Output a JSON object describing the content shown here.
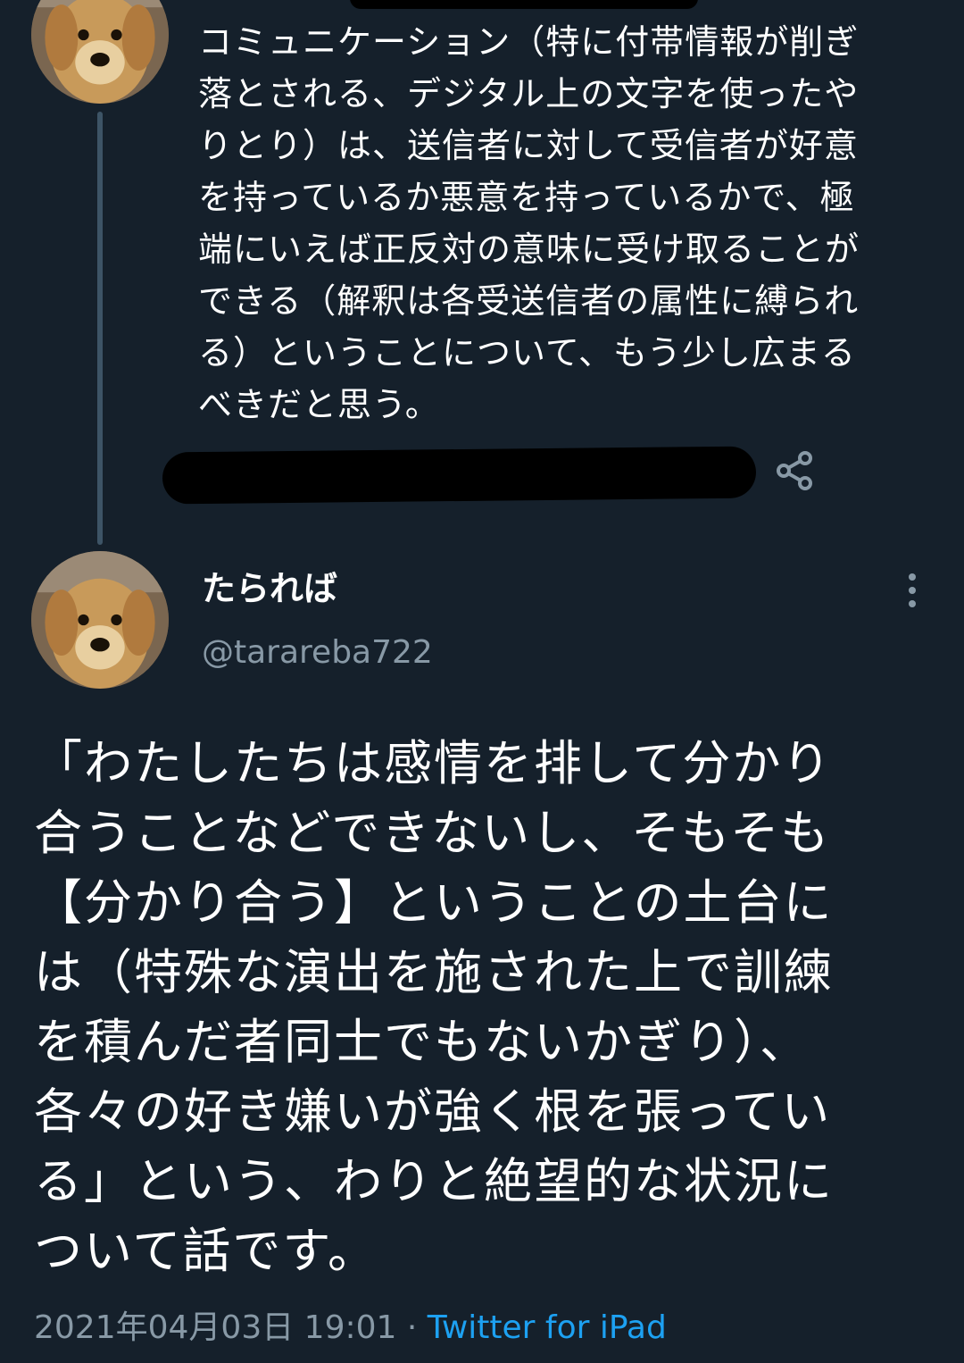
{
  "previous_tweet": {
    "text_lines": [
      "コミュニケーション（特に付帯情報が削ぎ",
      "落とされる、デジタル上の文字を使ったや",
      "りとり）は、送信者に対して受信者が好意",
      "を持っているか悪意を持っているかで、極",
      "端にいえば正反対の意味に受け取ることが",
      "できる（解釈は各受送信者の属性に縛られ",
      "る）ということについて、もう少し広まる",
      "べきだと思う。"
    ],
    "share_icon": "share-icon"
  },
  "tweet": {
    "display_name": "たられば",
    "handle": "@tarareba722",
    "text_lines": [
      "「わたしたちは感情を排して分かり",
      "合うことなどできないし、そもそも",
      "【分かり合う】ということの土台に",
      "は（特殊な演出を施された上で訓練",
      "を積んだ者同士でもないかぎり）、",
      "各々の好き嫌いが強く根を張ってい",
      "る」という、わりと絶望的な状況に",
      "ついて話です。"
    ],
    "timestamp": "2021年04月03日 19:01",
    "separator": "·",
    "source": "Twitter for iPad",
    "more_icon": "more-vertical-icon"
  },
  "colors": {
    "background": "#15202b",
    "text": "#ffffff",
    "secondary": "#8899a6",
    "link": "#1da1f2",
    "thread_line": "#3d5466"
  }
}
